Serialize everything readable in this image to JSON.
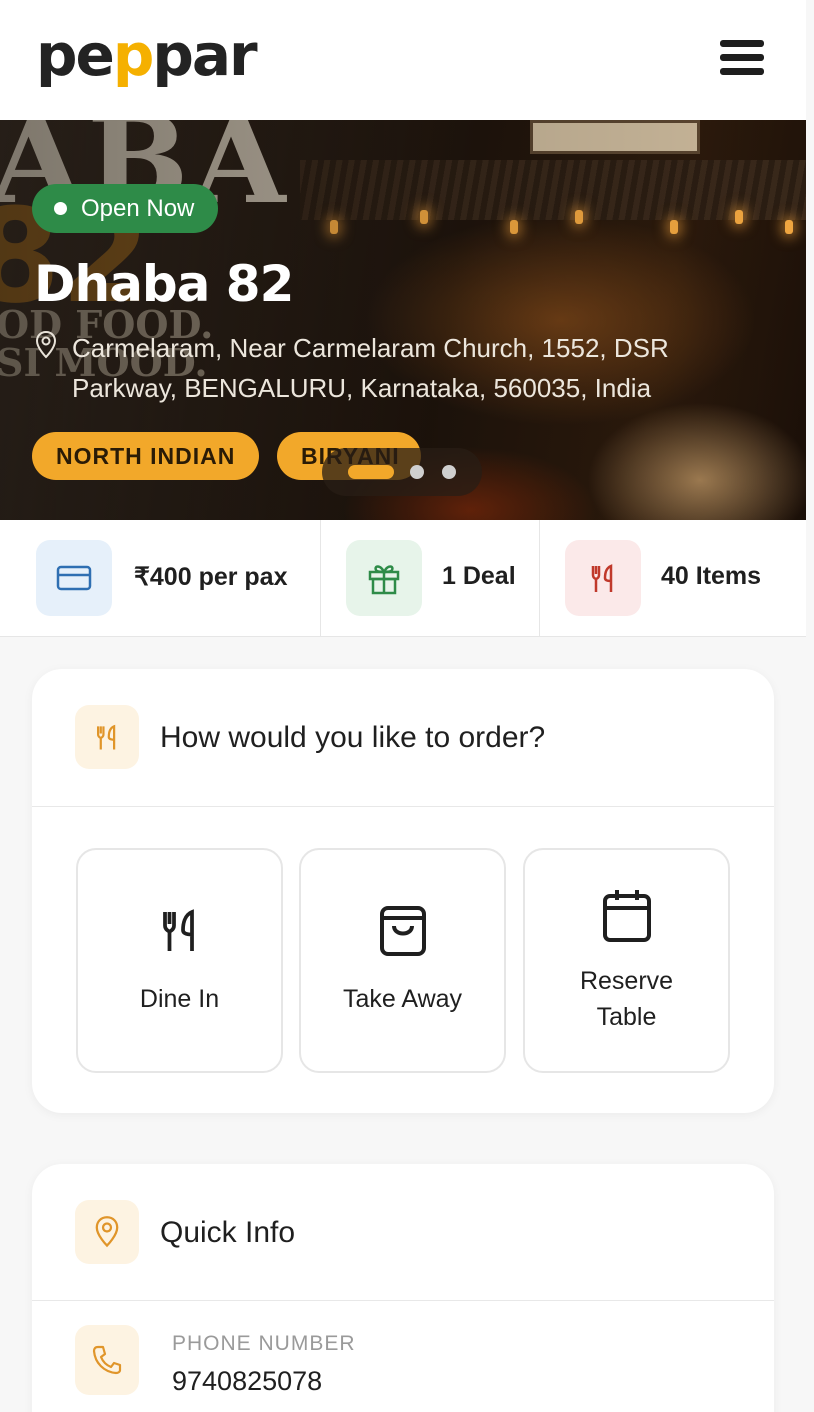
{
  "brand": {
    "logo_prefix": "pe",
    "logo_accent": "p",
    "logo_suffix": "par",
    "accent_color": "#f5b000"
  },
  "header": {
    "menu_icon": "hamburger-menu-icon"
  },
  "hero": {
    "status": "Open Now",
    "status_color": "#2e8b48",
    "name": "Dhaba 82",
    "address": "Carmelaram, Near Carmelaram Church, 1552, DSR Parkway, BENGALURU, Karnataka, 560035, India",
    "tags": [
      "NORTH INDIAN",
      "BIRYANI"
    ],
    "tag_color": "#f2a82a",
    "carousel": {
      "total": 3,
      "active": 1
    }
  },
  "stats": [
    {
      "icon": "card-icon",
      "label": "₹400 per pax"
    },
    {
      "icon": "gift-icon",
      "label": "1 Deal"
    },
    {
      "icon": "cutlery-icon",
      "label": "40 Items"
    }
  ],
  "order": {
    "title": "How would you like to order?",
    "options": [
      {
        "icon": "cutlery-icon",
        "label": "Dine In"
      },
      {
        "icon": "bag-icon",
        "label": "Take Away"
      },
      {
        "icon": "calendar-icon",
        "label": "Reserve Table"
      }
    ]
  },
  "quick_info": {
    "title": "Quick Info",
    "phone_label": "PHONE NUMBER",
    "phone_value": "9740825078"
  }
}
